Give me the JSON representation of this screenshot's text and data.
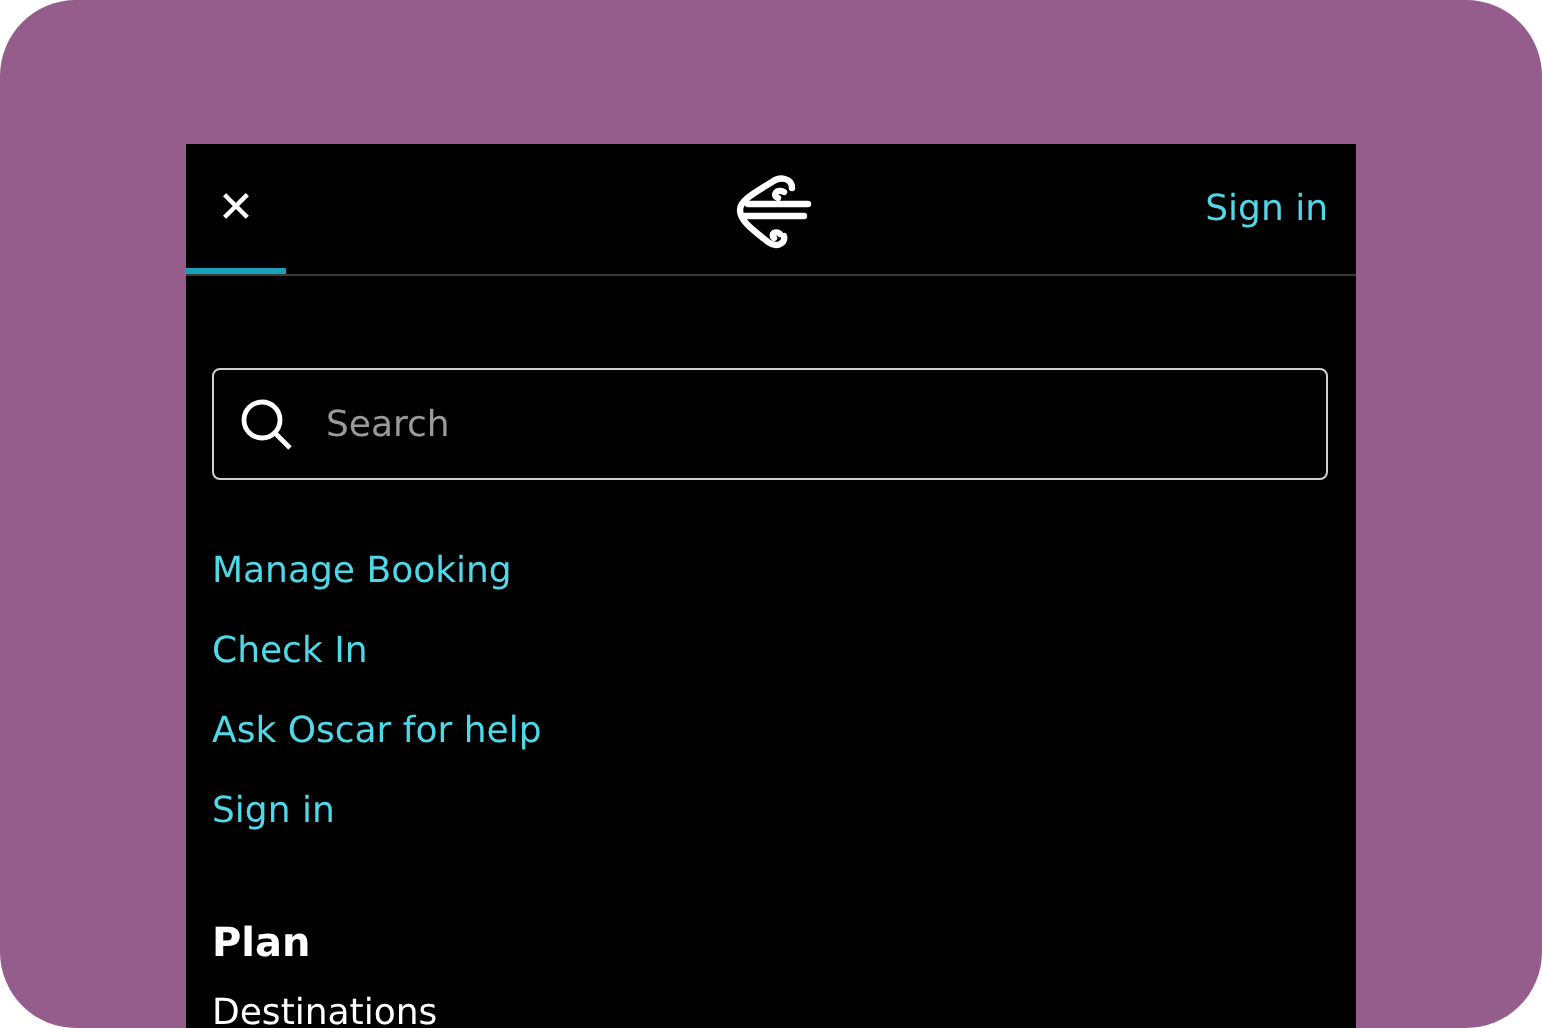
{
  "header": {
    "close_label": "✕",
    "sign_in": "Sign in",
    "close_selected": true
  },
  "search": {
    "placeholder": "Search"
  },
  "links": [
    "Manage Booking",
    "Check In",
    "Ask Oscar for help",
    "Sign in"
  ],
  "sections": [
    {
      "title": "Plan",
      "items": [
        "Destinations"
      ]
    }
  ]
}
